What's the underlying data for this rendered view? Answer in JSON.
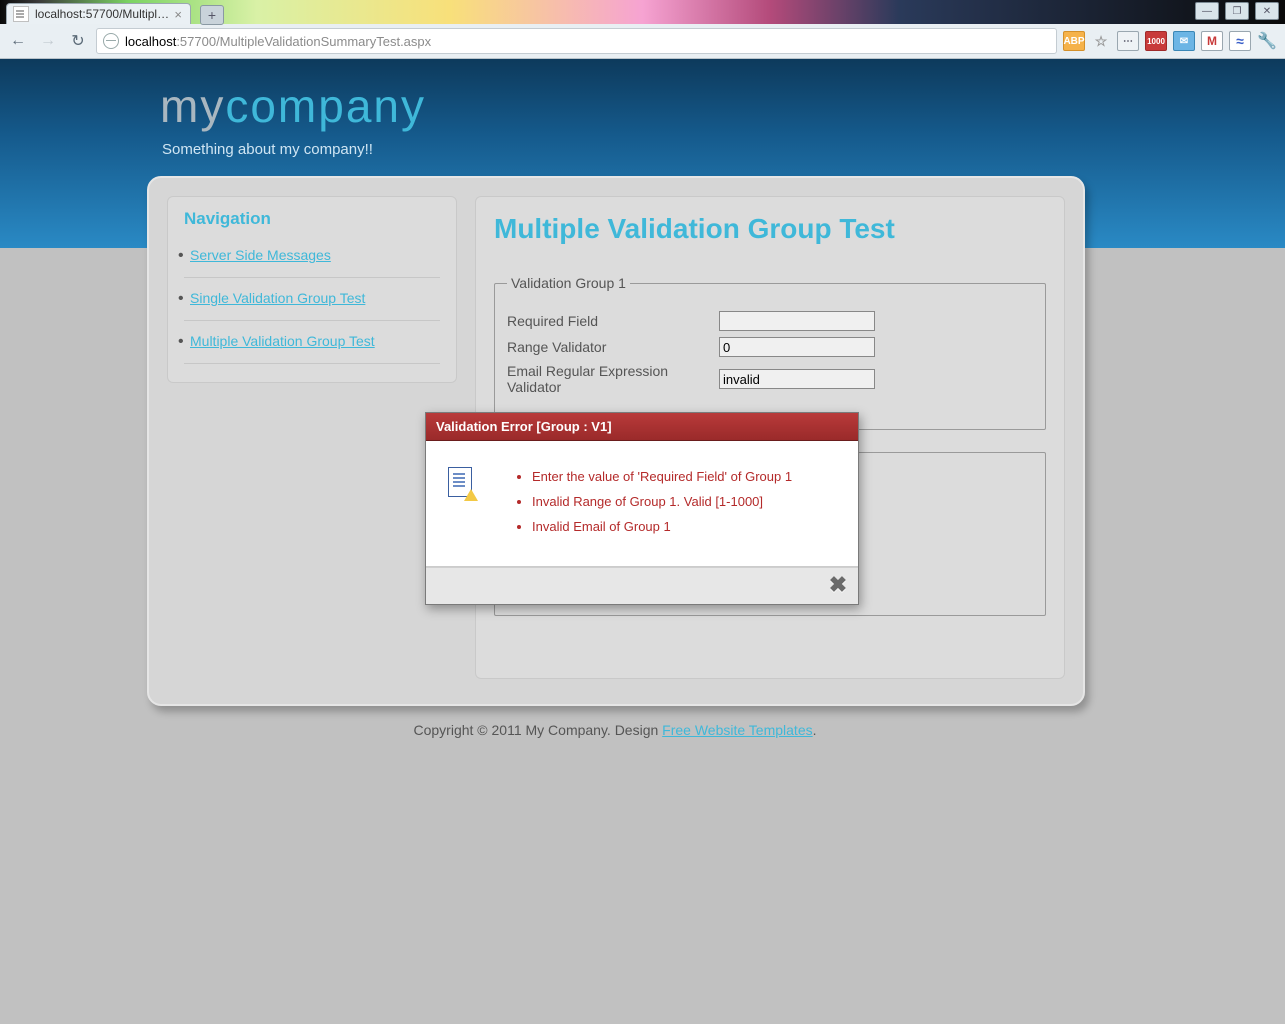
{
  "browser": {
    "tab_title": "localhost:57700/MultipleVal...",
    "new_tab_glyph": "+",
    "url_host": "localhost",
    "url_port_path": ":57700/MultipleValidationSummaryTest.aspx",
    "window_buttons": {
      "min": "—",
      "max": "❐",
      "close": "✕"
    },
    "nav": {
      "back": "←",
      "forward": "→",
      "reload": "↻"
    },
    "ext": {
      "abp": "ABP",
      "star": "☆",
      "a1": "⋯",
      "feed": "1000",
      "mail": "✉",
      "gmail": "M",
      "wave": "≈",
      "wrench": "🔧"
    }
  },
  "header": {
    "brand_part1": "my",
    "brand_part2": "company",
    "tagline": "Something about my company!!"
  },
  "sidebar": {
    "title": "Navigation",
    "items": [
      {
        "label": "Server Side Messages"
      },
      {
        "label": "Single Validation Group Test"
      },
      {
        "label": "Multiple Validation Group Test"
      }
    ]
  },
  "main": {
    "title": "Multiple Validation Group Test",
    "group1": {
      "legend": "Validation Group 1",
      "fields": {
        "required": {
          "label": "Required Field",
          "value": ""
        },
        "range": {
          "label": "Range Validator",
          "value": "0"
        },
        "email": {
          "label": "Email Regular Expression Validator",
          "value": "invalid"
        }
      }
    },
    "group2": {
      "legend": ""
    }
  },
  "dialog": {
    "title": "Validation Error [Group : V1]",
    "messages": [
      "Enter the value of 'Required Field' of Group 1",
      "Invalid Range of Group 1. Valid [1-1000]",
      "Invalid Email of Group 1"
    ],
    "close_glyph": "✖"
  },
  "footer": {
    "text": "Copyright © 2011 My Company. Design ",
    "link": "Free Website Templates",
    "suffix": "."
  }
}
